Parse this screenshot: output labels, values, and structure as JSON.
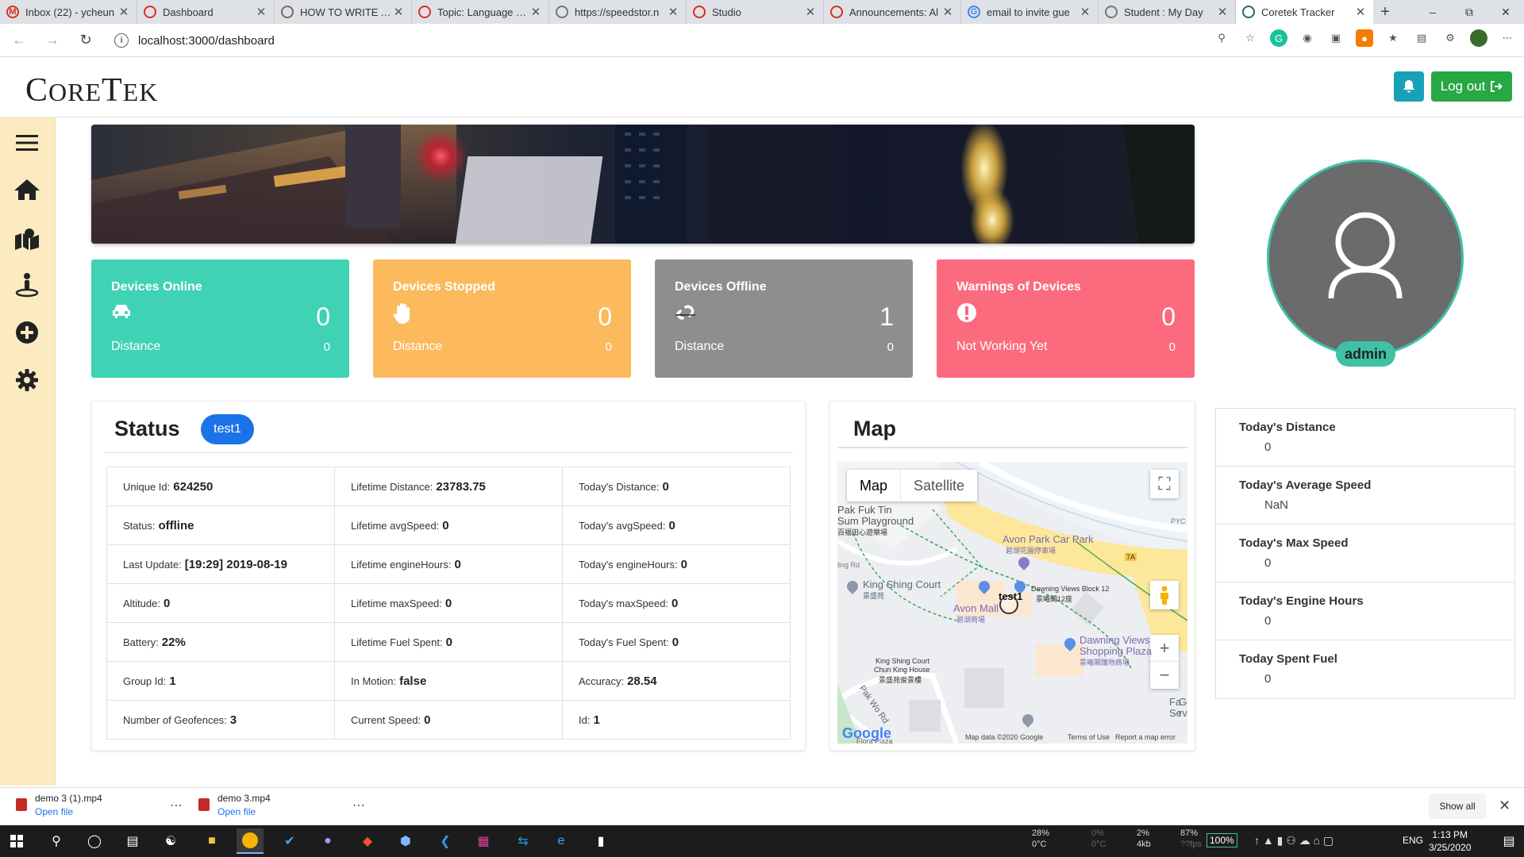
{
  "browser": {
    "tabs": [
      {
        "title": "Inbox (22) - ycheun",
        "fav": "M",
        "favColor": "#d93025"
      },
      {
        "title": "Dashboard",
        "fav": "",
        "favColor": "#d93025"
      },
      {
        "title": "HOW TO WRITE A C",
        "fav": "",
        "favColor": "#7a6a5a"
      },
      {
        "title": "Topic: Language Op",
        "fav": "",
        "favColor": "#d93025"
      },
      {
        "title": "https://speedstor.n",
        "fav": "",
        "favColor": "#777777"
      },
      {
        "title": "Studio",
        "fav": "",
        "favColor": "#d93025"
      },
      {
        "title": "Announcements: Al",
        "fav": "",
        "favColor": "#d93025"
      },
      {
        "title": "email to invite gue",
        "fav": "G",
        "favColor": "#4285f4"
      },
      {
        "title": "Student : My Day",
        "fav": "",
        "favColor": "#777777"
      },
      {
        "title": "Coretek Tracker",
        "fav": "",
        "favColor": "#1b6f6a"
      }
    ],
    "url": "localhost:3000/dashboard"
  },
  "header": {
    "logo_c": "C",
    "logo_ore": "ORE",
    "logo_t": "T",
    "logo_ek": "EK",
    "logout_label": "Log out"
  },
  "cards": [
    {
      "title": "Devices Online",
      "value": "0",
      "label": "Distance",
      "sub": "0",
      "color": "#3fd2b4",
      "icon": "car-icon"
    },
    {
      "title": "Devices Stopped",
      "value": "0",
      "label": "Distance",
      "sub": "0",
      "color": "#fcba5c",
      "icon": "hand-icon"
    },
    {
      "title": "Devices Offline",
      "value": "1",
      "label": "Distance",
      "sub": "0",
      "color": "#8e8e8e",
      "icon": "unlink-icon"
    },
    {
      "title": "Warnings of Devices",
      "value": "0",
      "label": "Not Working Yet",
      "sub": "0",
      "color": "#fc6a7e",
      "icon": "exclamation-icon"
    }
  ],
  "status": {
    "title": "Status",
    "device": "test1",
    "rows": [
      [
        {
          "k": "Unique Id:",
          "v": "624250"
        },
        {
          "k": "Lifetime Distance:",
          "v": "23783.75"
        },
        {
          "k": "Today's Distance:",
          "v": "0"
        }
      ],
      [
        {
          "k": "Status:",
          "v": "offline"
        },
        {
          "k": "Lifetime avgSpeed:",
          "v": "0"
        },
        {
          "k": "Today's avgSpeed:",
          "v": "0"
        }
      ],
      [
        {
          "k": "Last Update:",
          "v": "[19:29] 2019-08-19"
        },
        {
          "k": "Lifetime engineHours:",
          "v": "0"
        },
        {
          "k": "Today's engineHours:",
          "v": "0"
        }
      ],
      [
        {
          "k": "Altitude:",
          "v": "0"
        },
        {
          "k": "Lifetime maxSpeed:",
          "v": "0"
        },
        {
          "k": "Today's maxSpeed:",
          "v": "0"
        }
      ],
      [
        {
          "k": "Battery:",
          "v": "22%"
        },
        {
          "k": "Lifetime Fuel Spent:",
          "v": "0"
        },
        {
          "k": "Today's Fuel Spent:",
          "v": "0"
        }
      ],
      [
        {
          "k": "Group Id:",
          "v": "1"
        },
        {
          "k": "In Motion:",
          "v": "false"
        },
        {
          "k": "Accuracy:",
          "v": "28.54"
        }
      ],
      [
        {
          "k": "Number of Geofences:",
          "v": "3"
        },
        {
          "k": "Current Speed:",
          "v": "0"
        },
        {
          "k": "Id:",
          "v": "1"
        }
      ]
    ]
  },
  "map": {
    "title": "Map",
    "tab_map": "Map",
    "tab_satellite": "Satellite",
    "labels": {
      "pak_fuk_tin": "Pak Fuk Tin",
      "sum_playground": "Sum Playground",
      "sum_playground_zh": "百福田心遊樂場",
      "avon_park": "Avon Park Car Park",
      "avon_park_zh": "碧湖花園停車場",
      "king_shing": "King Shing Court",
      "king_shing_zh": "景盛苑",
      "avon_mall": "Avon Mall",
      "avon_mall_zh": "碧湖商場",
      "dawning_block": "Dawning Views Block 12",
      "dawning_block_zh": "景曦閣12座",
      "test1": "test1",
      "dawning_plaza": "Dawning Views",
      "dawning_plaza2": "Shopping Plaza",
      "dawning_plaza_zh": "景曦閣購物商場",
      "kingshing_chun": "King Shing Court",
      "kingshing_chun2": "Chun King House",
      "kingshing_chun_zh": "景盛苑俊景樓",
      "pak_wo": "Pak Wo Rd",
      "road_7a": "7A",
      "pyc": "PYC",
      "ling_rd": "ling Rd",
      "flora": "Flora Plaza",
      "fa": "Fa",
      "se": "Se",
      "go": "Go",
      "rv": "rv"
    },
    "google": "Google",
    "mapdata": "Map data ©2020 Google",
    "terms": "Terms of Use",
    "report": "Report a map error"
  },
  "profile": {
    "name": "admin"
  },
  "today": [
    {
      "label": "Today's Distance",
      "value": "0"
    },
    {
      "label": "Today's Average Speed",
      "value": "NaN"
    },
    {
      "label": "Today's Max Speed",
      "value": "0"
    },
    {
      "label": "Today's Engine Hours",
      "value": "0"
    },
    {
      "label": "Today Spent Fuel",
      "value": "0"
    }
  ],
  "downloads": [
    {
      "name": "demo 3 (1).mp4",
      "action": "Open file"
    },
    {
      "name": "demo 3.mp4",
      "action": "Open file"
    }
  ],
  "downloads_showall": "Show all",
  "taskbar": {
    "cpu": "28%",
    "cpu_temp": "0°C",
    "gpu": "0%",
    "gpu_temp": "0°C",
    "mem": "2%",
    "mem_sub": "4kb",
    "bat": "87%",
    "bat_sub": "??fps",
    "zoom": "100%",
    "lang": "ENG",
    "time": "1:13 PM",
    "date": "3/25/2020"
  }
}
